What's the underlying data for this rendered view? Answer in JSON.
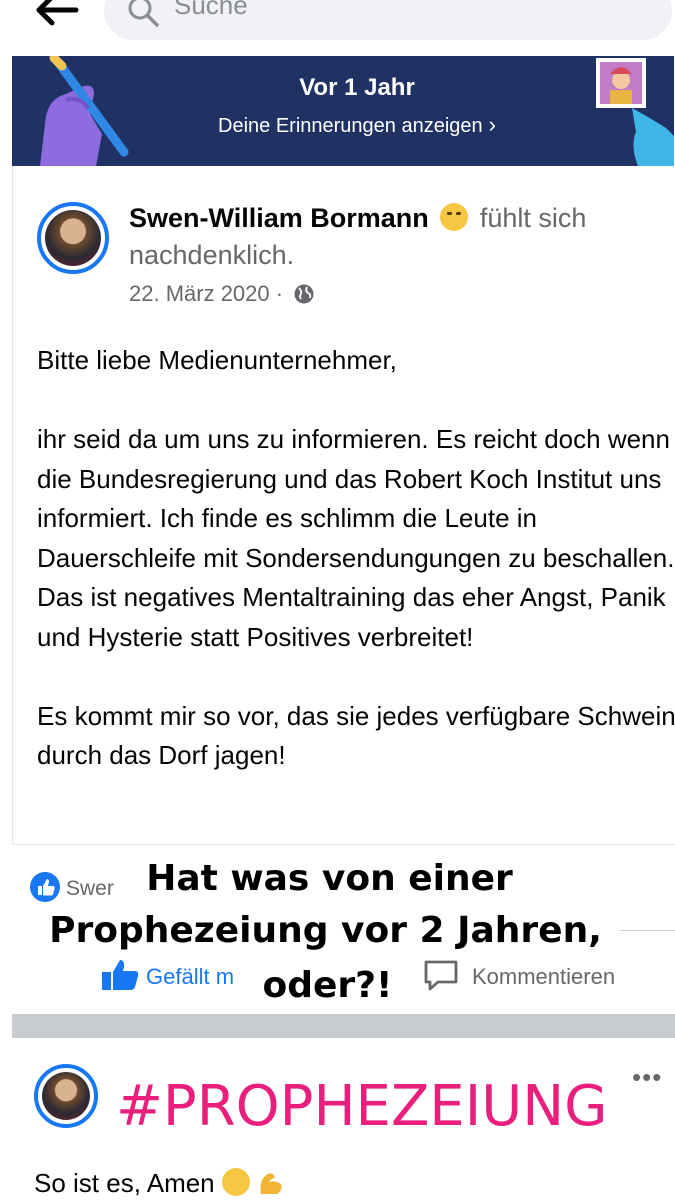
{
  "search": {
    "placeholder": "Suche"
  },
  "memory_banner": {
    "title": "Vor 1 Jahr",
    "link_label": "Deine Erinnerungen anzeigen"
  },
  "post": {
    "author": "Swen-William Bormann",
    "feeling": "fühlt sich nachdenklich.",
    "date": "22. März 2020",
    "paragraphs": [
      "Bitte liebe Medienunternehmer,",
      "ihr seid da um uns zu informieren. Es reicht doch wenn die Bundesregierung und das Robert Koch Institut uns informiert. Ich finde es schlimm die Leute in Dauerschleife mit Sondersendungungen zu beschallen. Das ist negatives Mentaltraining das eher Angst, Panik und Hysterie statt Positives verbreitet!",
      "Es kommt mir so vor, das sie jedes verfügbare Schwein durch das Dorf jagen!"
    ],
    "reactions_text": "Swer",
    "like_label": "Gefällt m",
    "comment_label": "Kommentieren"
  },
  "overlay": {
    "line1": "Hat was von  einer",
    "line2": "Prophezeiung vor 2 Jahren,",
    "line3": "oder?!"
  },
  "second_post": {
    "hashtag": "#PROPHEZEIUNG",
    "text": "So ist es, Amen"
  },
  "colors": {
    "banner_bg": "#1f3263",
    "accent": "#1877f2",
    "hashtag": "#ea1e7c"
  }
}
